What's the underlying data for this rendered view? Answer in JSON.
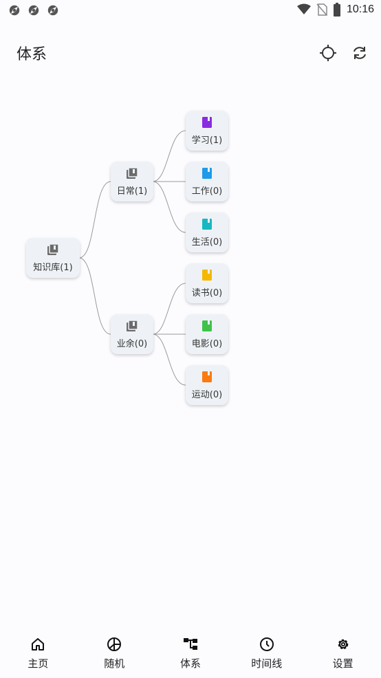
{
  "status_bar": {
    "time": "10:16",
    "notification_icons": [
      "app-notification-icon",
      "app-notification-icon",
      "app-notification-icon"
    ],
    "system_icons": [
      "wifi-icon",
      "no-sim-icon",
      "battery-icon"
    ]
  },
  "header": {
    "title": "体系",
    "actions": [
      "locate-icon",
      "sync-icon"
    ]
  },
  "tree": {
    "root": {
      "label": "知识库(1)",
      "icon": "library-icon",
      "color": "#6b6b6b"
    },
    "groups": [
      {
        "label": "日常(1)",
        "icon": "library-icon",
        "color": "#6b6b6b",
        "children": [
          {
            "label": "学习(1)",
            "icon": "book-icon",
            "color": "#8a2be2"
          },
          {
            "label": "工作(0)",
            "icon": "book-icon",
            "color": "#1e9be9"
          },
          {
            "label": "生活(0)",
            "icon": "book-icon",
            "color": "#18b8c2"
          }
        ]
      },
      {
        "label": "业余(0)",
        "icon": "library-icon",
        "color": "#6b6b6b",
        "children": [
          {
            "label": "读书(0)",
            "icon": "book-icon",
            "color": "#f5b800"
          },
          {
            "label": "电影(0)",
            "icon": "book-icon",
            "color": "#3fc24a"
          },
          {
            "label": "运动(0)",
            "icon": "book-icon",
            "color": "#fb7a10"
          }
        ]
      }
    ]
  },
  "bottom_nav": {
    "items": [
      {
        "label": "主页",
        "icon": "home-icon"
      },
      {
        "label": "随机",
        "icon": "random-icon"
      },
      {
        "label": "体系",
        "icon": "hierarchy-icon"
      },
      {
        "label": "时间线",
        "icon": "clock-icon"
      },
      {
        "label": "设置",
        "icon": "gear-icon"
      }
    ]
  }
}
